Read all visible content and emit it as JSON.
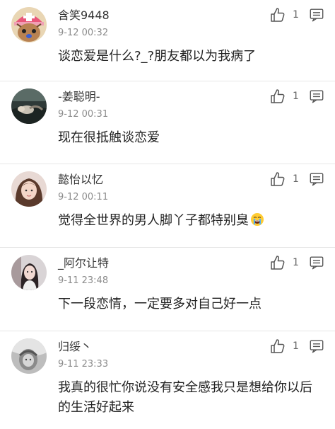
{
  "comments": [
    {
      "username": "含笑9448",
      "time": "9-12 00:32",
      "text": "谈恋爱是什么?_?朋友都以为我病了",
      "likes": "1",
      "avatar": "cartoon-character-avatar"
    },
    {
      "username": "-姜聪明-",
      "time": "9-12 00:31",
      "text": "现在很抵触谈恋爱",
      "likes": "1",
      "avatar": "photo-avatar"
    },
    {
      "username": "懿怡以忆",
      "time": "9-12 00:11",
      "text": "觉得全世界的男人脚丫子都特别臭",
      "likes": "1",
      "avatar": "photo-avatar",
      "emoji": "crying-face-emoji"
    },
    {
      "username": "_阿尔让特",
      "time": "9-11 23:48",
      "text": "下一段恋情，一定要多对自己好一点",
      "likes": "1",
      "avatar": "photo-avatar"
    },
    {
      "username": "归绥丶",
      "time": "9-11 23:33",
      "text": "我真的很忙你说没有安全感我只是想给你以后的生活好起来",
      "likes": "1",
      "avatar": "photo-avatar"
    }
  ],
  "icons": {
    "like": "thumbs-up-icon",
    "reply": "comment-icon"
  },
  "colors": {
    "username": "#333333",
    "time": "#8c8c8c",
    "divider": "#e6e6e6",
    "icon": "#555555"
  }
}
